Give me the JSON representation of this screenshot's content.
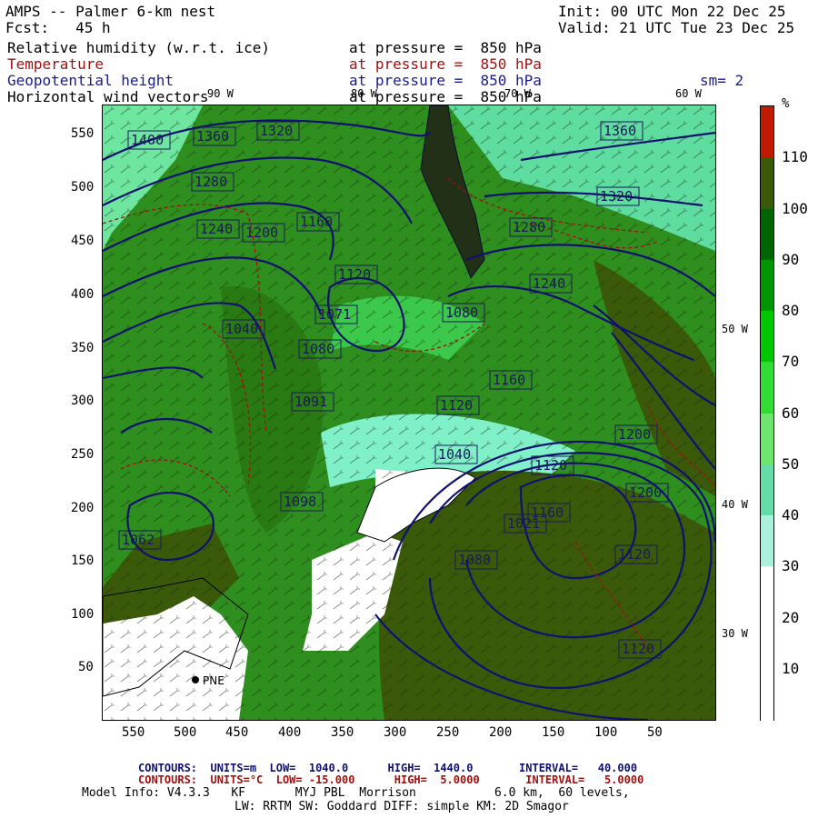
{
  "header": {
    "title": "AMPS -- Palmer 6-km nest",
    "fcst": "Fcst:   45 h",
    "init": "Init: 00 UTC Mon 22 Dec 25",
    "valid": "Valid: 21 UTC Tue 23 Dec 25",
    "fields": [
      {
        "name": "Relative humidity (w.r.t. ice)",
        "level": "at pressure =  850 hPa",
        "color": "#000000"
      },
      {
        "name": "Temperature",
        "level": "at pressure =  850 hPa",
        "color": "#a01010"
      },
      {
        "name": "Geopotential height",
        "level": "at pressure =  850 hPa",
        "color": "#1a1a8c"
      },
      {
        "name": "Horizontal wind vectors",
        "level": "at pressure =  850 hPa",
        "color": "#000000"
      }
    ],
    "smoothing": "sm= 2"
  },
  "axes": {
    "x_ticks": [
      "550",
      "500",
      "450",
      "400",
      "350",
      "300",
      "250",
      "200",
      "150",
      "100",
      "50"
    ],
    "y_ticks": [
      "550",
      "500",
      "450",
      "400",
      "350",
      "300",
      "250",
      "200",
      "150",
      "100",
      "50"
    ],
    "lon_labels_top": [
      "90 W",
      "80 W",
      "70 W",
      "60 W"
    ],
    "lon_labels_right": [
      "50 W",
      "40 W",
      "30 W"
    ]
  },
  "colorbar": {
    "unit": "%",
    "labels": [
      "110",
      "100",
      "90",
      "80",
      "70",
      "60",
      "50",
      "40",
      "30",
      "20",
      "10"
    ],
    "colors": [
      "#c01a00",
      "#3a5a0a",
      "#006400",
      "#009600",
      "#00c800",
      "#32dc32",
      "#6ee66e",
      "#64dcaa",
      "#aaf0dc",
      "#ffffff",
      "#ffffff",
      "#ffffff"
    ]
  },
  "map": {
    "station": "PNE",
    "height_labels": [
      "1400",
      "1360",
      "1320",
      "1280",
      "1240",
      "1200",
      "1160",
      "1120",
      "1080",
      "1040",
      "1071",
      "1091",
      "1098",
      "1062",
      "1021"
    ],
    "height_labels_placed": [
      {
        "t": "1400"
      },
      {
        "t": "1360"
      },
      {
        "t": "1320"
      },
      {
        "t": "1280"
      },
      {
        "t": "1240"
      },
      {
        "t": "1200"
      },
      {
        "t": "1160"
      },
      {
        "t": "1120"
      },
      {
        "t": "1080"
      },
      {
        "t": "1040"
      },
      {
        "t": "1071"
      },
      {
        "t": "1091"
      },
      {
        "t": "1098"
      },
      {
        "t": "1062"
      },
      {
        "t": "1021"
      },
      {
        "t": "1360"
      },
      {
        "t": "1320"
      },
      {
        "t": "1280"
      },
      {
        "t": "1240"
      },
      {
        "t": "1200"
      },
      {
        "t": "1160"
      },
      {
        "t": "1120"
      },
      {
        "t": "1080"
      },
      {
        "t": "1040"
      },
      {
        "t": "1120"
      },
      {
        "t": "1160"
      },
      {
        "t": "1200"
      },
      {
        "t": "1120"
      },
      {
        "t": "1080"
      },
      {
        "t": "1120"
      }
    ]
  },
  "footer": {
    "contours1": "CONTOURS:  UNITS=m  LOW=  1040.0      HIGH=  1440.0       INTERVAL=   40.000",
    "contours2": "CONTOURS:  UNITS=°C  LOW= -15.000      HIGH=  5.0000       INTERVAL=   5.0000",
    "model1": "Model Info: V4.3.3   KF       MYJ PBL  Morrison           6.0 km,  60 levels,",
    "model2": "LW: RRTM SW: Goddard DIFF: simple KM: 2D Smagor"
  }
}
